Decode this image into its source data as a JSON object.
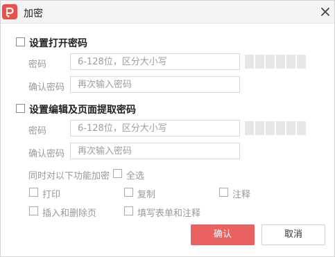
{
  "window": {
    "title": "加密",
    "icon": "pdf-logo-icon",
    "close_icon": "close-icon"
  },
  "open_password": {
    "checkbox_label": "设置打开密码",
    "password_label": "密码",
    "password_placeholder": "6-128位，区分大小写",
    "confirm_label": "确认密码",
    "confirm_placeholder": "再次输入密码"
  },
  "edit_password": {
    "checkbox_label": "设置编辑及页面提取密码",
    "password_label": "密码",
    "password_placeholder": "6-128位，区分大小写",
    "confirm_label": "确认密码",
    "confirm_placeholder": "再次输入密码",
    "encrypt_features_label": "同时对以下功能加密",
    "select_all_label": "全选",
    "options": {
      "print": "打印",
      "copy": "复制",
      "annotate": "注释",
      "insert_delete": "插入和删除页",
      "fill_form": "填写表单和注释"
    }
  },
  "buttons": {
    "ok": "确认",
    "cancel": "取消"
  },
  "colors": {
    "accent": "#e8625f",
    "titlebar": "#f3f3f3",
    "strength_block": "#e6e6e6"
  }
}
